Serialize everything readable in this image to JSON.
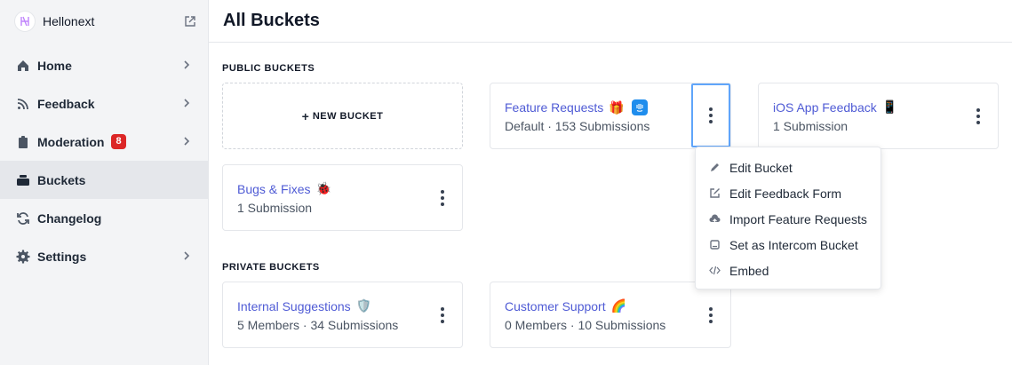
{
  "sidebar": {
    "brand": "Hellonext",
    "items": [
      {
        "label": "Home"
      },
      {
        "label": "Feedback"
      },
      {
        "label": "Moderation",
        "badge": "8"
      },
      {
        "label": "Buckets"
      },
      {
        "label": "Changelog"
      },
      {
        "label": "Settings"
      }
    ]
  },
  "header": {
    "title": "All Buckets"
  },
  "public": {
    "title": "PUBLIC BUCKETS",
    "new_bucket": "NEW BUCKET",
    "buckets": [
      {
        "name": "Feature Requests",
        "emoji": "🎁",
        "meta": "Default · 153 Submissions"
      },
      {
        "name": "iOS App Feedback",
        "emoji": "📱",
        "meta": "1 Submission"
      },
      {
        "name": "Bugs & Fixes",
        "emoji": "🐞",
        "meta": "1 Submission"
      }
    ]
  },
  "private": {
    "title": "PRIVATE BUCKETS",
    "buckets": [
      {
        "name": "Internal Suggestions",
        "emoji": "🛡️",
        "meta": "5 Members · 34 Submissions"
      },
      {
        "name": "Customer Support",
        "emoji": "🌈",
        "meta": "0 Members · 10 Submissions"
      }
    ]
  },
  "menu": {
    "items": [
      {
        "label": "Edit Bucket"
      },
      {
        "label": "Edit Feedback Form"
      },
      {
        "label": "Import Feature Requests"
      },
      {
        "label": "Set as Intercom Bucket"
      },
      {
        "label": "Embed"
      }
    ]
  },
  "colors": {
    "accent": "#4f5bd5",
    "badge": "#dc2626",
    "focus": "#60a5fa",
    "intercom": "#1f8ded"
  }
}
